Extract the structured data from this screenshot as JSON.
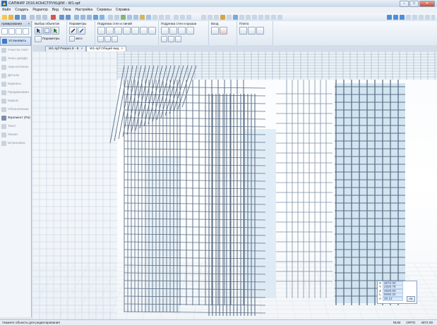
{
  "window": {
    "title": "САПФИР 2016-КОНСТРУКЦИИ - W1.spf",
    "controls": [
      "–",
      "□",
      "✕"
    ]
  },
  "menu": [
    "Файл",
    "Создать",
    "Редактор",
    "Вид",
    "Окна",
    "Настройка",
    "Сервисы",
    "Справка"
  ],
  "ribbon": {
    "groups": [
      {
        "title": "Выбор объектов",
        "extra": "Параметры"
      },
      {
        "title": "Параметры",
        "extra": "авто"
      },
      {
        "title": "Подрезка стен и линий"
      },
      {
        "title": "Подрезка стен и крыши"
      },
      {
        "title": "Вход"
      },
      {
        "title": "Плита"
      }
    ]
  },
  "left_panel": {
    "header": "Армирование",
    "items": [
      {
        "label": "Установить",
        "state": "active"
      },
      {
        "label": "Участок плит",
        "state": "dim"
      },
      {
        "label": "Зоны диафр.",
        "state": "dim"
      },
      {
        "label": "Арм.колонны",
        "state": "dim"
      },
      {
        "label": "Детали",
        "state": "dim"
      },
      {
        "label": "Каркасы",
        "state": "dim"
      },
      {
        "label": "Продавливан.",
        "state": "dim"
      },
      {
        "label": "Каркас",
        "state": "dim"
      },
      {
        "label": "Обозначение",
        "state": "dim"
      },
      {
        "label": "Фрагмент (Ра)",
        "state": "bold"
      },
      {
        "label": "Текст",
        "state": "dim"
      },
      {
        "label": "Линия",
        "state": "dim"
      },
      {
        "label": "Штриховка",
        "state": "dim"
      }
    ]
  },
  "tabs": [
    {
      "label": "W1.spf Разрез 8 - 8",
      "active": false
    },
    {
      "label": "W1.spf Общий вид",
      "active": true
    }
  ],
  "coord_panel": {
    "rows": [
      {
        "key": "X",
        "value": "4872.00"
      },
      {
        "key": "Y",
        "value": "2320.78"
      },
      {
        "key": "Z",
        "value": "2820.00"
      },
      {
        "key": "L",
        "value": "5080.22"
      },
      {
        "key": "A",
        "value": "25.12"
      }
    ],
    "ok_label": "Ok"
  },
  "status": {
    "hint": "Укажите объекты для редактирования",
    "indicators": [
      "NUM",
      "ORTO",
      "4872.00"
    ]
  },
  "colors": {
    "rebar": "#5b6f86",
    "rebar_light": "#9fb0c2",
    "column_fill": "#c7dfee",
    "accent": "#2f6fb6"
  }
}
